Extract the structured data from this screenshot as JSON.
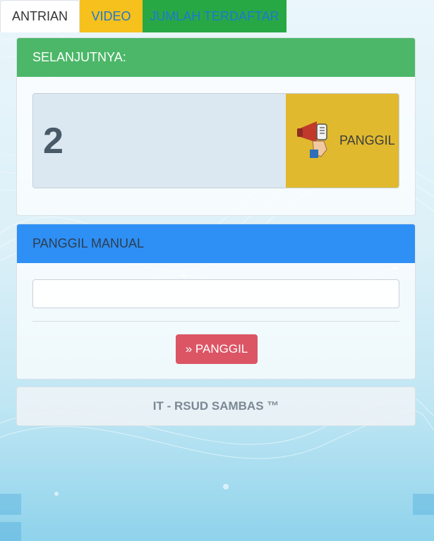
{
  "tabs": [
    {
      "label": "ANTRIAN"
    },
    {
      "label": "VIDEO"
    },
    {
      "label": "JUMLAH TERDAFTAR"
    }
  ],
  "next_panel": {
    "title": "SELANJUTNYA:",
    "queue_number": "2",
    "call_button_label": "PANGGIL",
    "call_icon": "megaphone-icon"
  },
  "manual_panel": {
    "title": "PANGGIL MANUAL",
    "input_value": "",
    "input_placeholder": "",
    "button_label": "» PANGGIL"
  },
  "footer": {
    "text": "IT - RSUD SAMBAS ™"
  },
  "colors": {
    "next_header": "#4cb768",
    "manual_header": "#2e8ff5",
    "call_button": "#e0b92e",
    "manual_button": "#dc5565",
    "tab_video": "#f6c11c",
    "tab_jumlah": "#28a845"
  }
}
